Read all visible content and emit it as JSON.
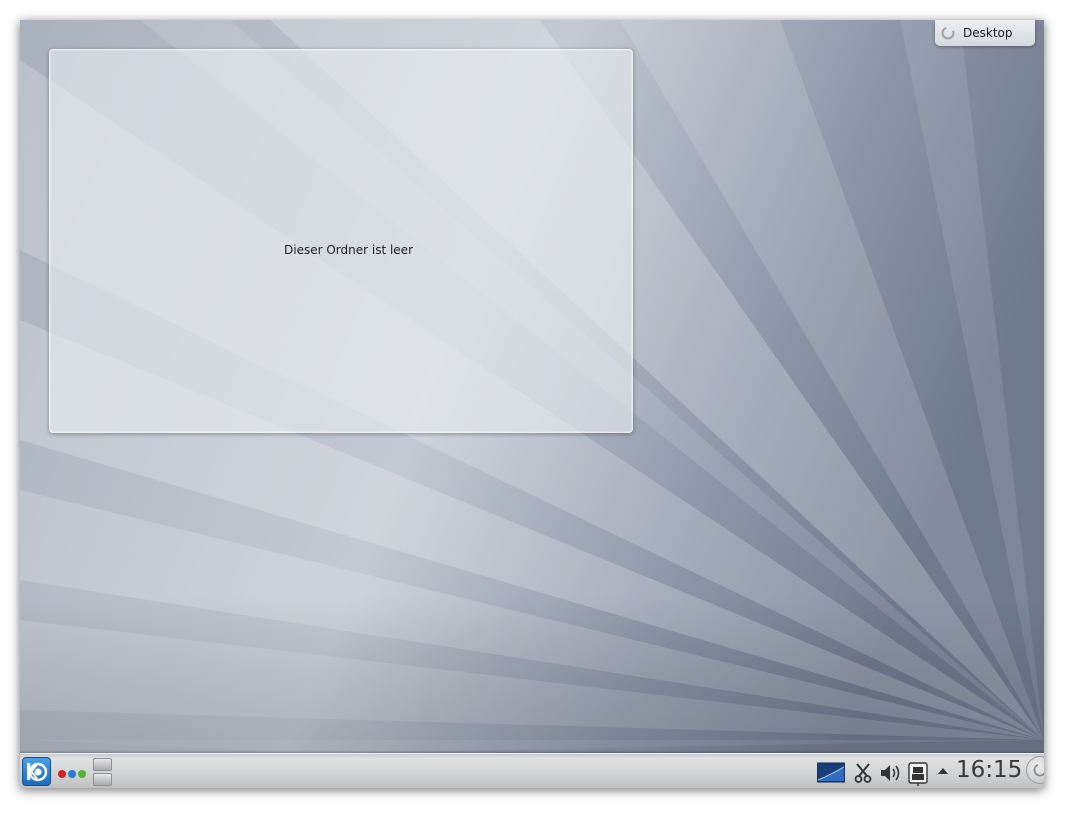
{
  "desktop": {
    "toolbox_label": "Desktop",
    "toolbox_icon": "cashew-icon"
  },
  "folderview": {
    "empty_message": "Dieser Ordner ist leer"
  },
  "panel": {
    "launcher_icon": "kde-kickoff-icon",
    "activity_dots_colors": [
      "#d42222",
      "#2f7ad6",
      "#4fb33a"
    ],
    "tray_icons": [
      "network-monitor-icon",
      "klipper-scissors-icon",
      "volume-icon",
      "keyboard-layout-icon",
      "tray-expand-arrow-icon"
    ],
    "clock": "16:15",
    "panel_toolbox_icon": "panel-toolbox-icon"
  },
  "colors": {
    "panel_bg": "#d3d4d6",
    "kickoff_blue": "#1f69bf"
  }
}
